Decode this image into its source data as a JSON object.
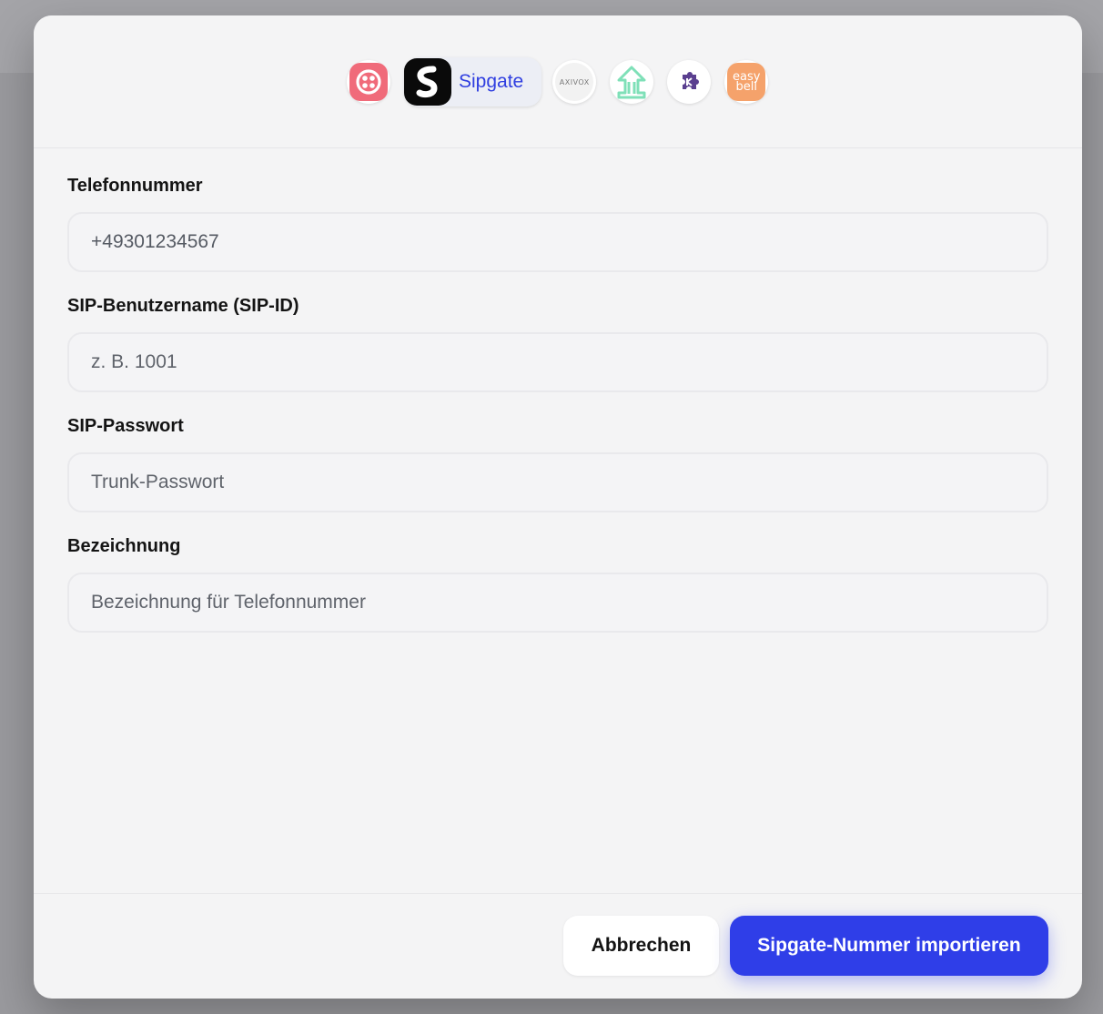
{
  "dialog": {
    "providers": [
      {
        "id": "twilio",
        "icon": "twilio-logo-icon",
        "color": "#f06b7a"
      },
      {
        "id": "sipgate",
        "icon": "sipgate-logo-icon",
        "label": "Sipgate",
        "selected": true,
        "color": "#0a0a0a"
      },
      {
        "id": "axivox",
        "icon": "axivox-logo-icon",
        "logo_text": "AXIVOX"
      },
      {
        "id": "provider-4",
        "icon": "green-arrows-logo-icon",
        "color": "#7fe0b8"
      },
      {
        "id": "provider-5",
        "icon": "purple-puzzle-logo-icon",
        "color": "#5a3f8f"
      },
      {
        "id": "easybell",
        "icon": "easybell-logo-icon",
        "logo_text_top": "easy",
        "logo_text_bottom": "bell",
        "color": "#f5a26b"
      }
    ],
    "fields": {
      "phone": {
        "label": "Telefonnummer",
        "value": "+49301234567"
      },
      "sip_username": {
        "label": "SIP-Benutzername (SIP-ID)",
        "placeholder": "z. B. 1001"
      },
      "sip_password": {
        "label": "SIP-Passwort",
        "placeholder": "Trunk-Passwort"
      },
      "designation": {
        "label": "Bezeichnung",
        "placeholder": "Bezeichnung für Telefonnummer"
      }
    },
    "footer": {
      "cancel_label": "Abbrechen",
      "submit_label": "Sipgate-Nummer importieren"
    },
    "colors": {
      "accent": "#2f3ee8",
      "modal_bg": "#f4f4f5"
    }
  }
}
